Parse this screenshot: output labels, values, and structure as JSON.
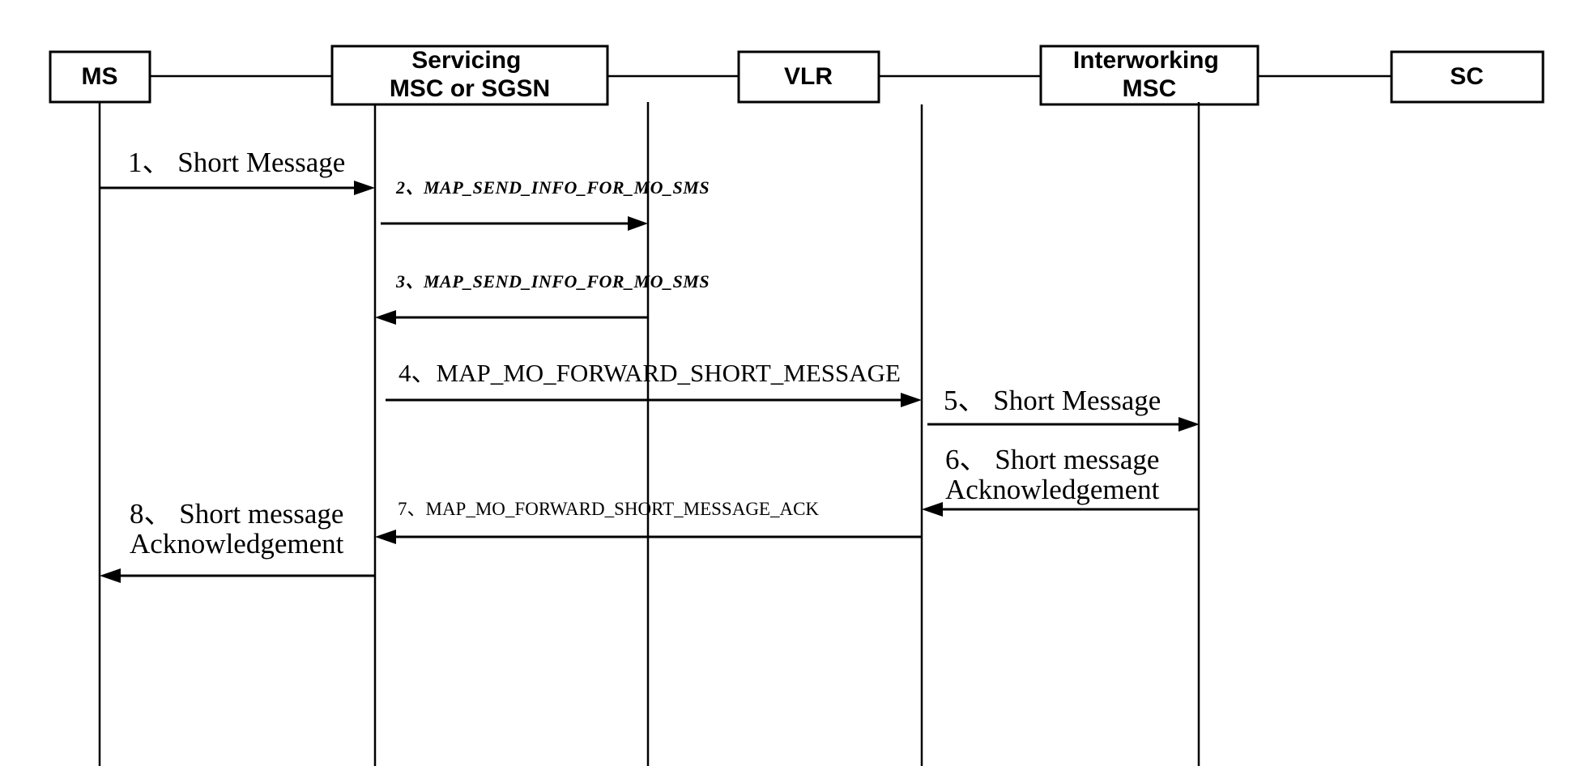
{
  "diagram": {
    "title": "Mobile Originated Short Message sequence",
    "type": "sequence-diagram",
    "background_color": "#ffffff",
    "line_color": "#000000"
  },
  "nodes": [
    {
      "id": "ms",
      "label": "MS",
      "label_lines": [
        "MS"
      ]
    },
    {
      "id": "msc",
      "label": "Servicing MSC or SGSN",
      "label_lines": [
        "Servicing",
        "MSC or SGSN"
      ]
    },
    {
      "id": "vlr",
      "label": "VLR",
      "label_lines": [
        "VLR"
      ]
    },
    {
      "id": "imsc",
      "label": "Interworking MSC",
      "label_lines": [
        "Interworking",
        "MSC"
      ]
    },
    {
      "id": "sc",
      "label": "SC",
      "label_lines": [
        "SC"
      ]
    }
  ],
  "messages": [
    {
      "number": "1",
      "text": "1、 Short Message",
      "lines": [
        "1、 Short Message"
      ],
      "from": "ms",
      "to": "msc",
      "direction": "right"
    },
    {
      "number": "2",
      "text": "2、MAP_SEND_INFO_FOR_MO_SMS",
      "lines": [
        "2、MAP_SEND_INFO_FOR_MO_SMS"
      ],
      "from": "msc",
      "to": "vlr",
      "direction": "right"
    },
    {
      "number": "3",
      "text": "3、MAP_SEND_INFO_FOR_MO_SMS",
      "lines": [
        "3、MAP_SEND_INFO_FOR_MO_SMS"
      ],
      "from": "vlr",
      "to": "msc",
      "direction": "left"
    },
    {
      "number": "4",
      "text": "4、MAP_MO_FORWARD_SHORT_MESSAGE",
      "lines": [
        "4、MAP_MO_FORWARD_SHORT_MESSAGE"
      ],
      "from": "msc",
      "to": "imsc",
      "direction": "right"
    },
    {
      "number": "5",
      "text": "5、 Short Message",
      "lines": [
        "5、 Short Message"
      ],
      "from": "imsc",
      "to": "sc",
      "direction": "right"
    },
    {
      "number": "6",
      "text": "6、 Short message Acknowledgement",
      "lines": [
        "6、 Short message",
        "Acknowledgement"
      ],
      "from": "sc",
      "to": "imsc",
      "direction": "left"
    },
    {
      "number": "7",
      "text": "7、MAP_MO_FORWARD_SHORT_MESSAGE_ACK",
      "lines": [
        "7、MAP_MO_FORWARD_SHORT_MESSAGE_ACK"
      ],
      "from": "imsc",
      "to": "msc",
      "direction": "left"
    },
    {
      "number": "8",
      "text": "8、 Short message Acknowledgement",
      "lines": [
        "8、 Short message",
        "Acknowledgement"
      ],
      "from": "msc",
      "to": "ms",
      "direction": "left"
    }
  ]
}
